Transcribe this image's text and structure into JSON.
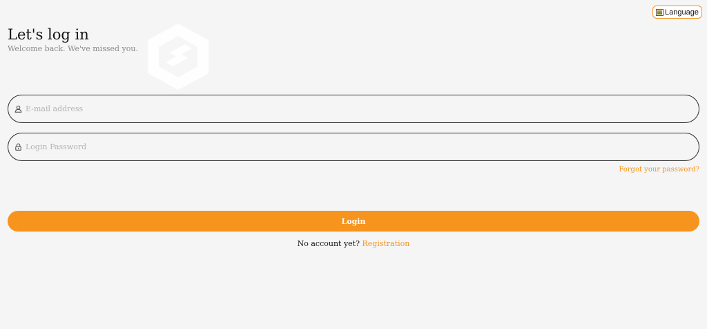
{
  "header": {
    "language_label": "Language",
    "language_icon": "flag-icon"
  },
  "hero": {
    "title": "Let's log in",
    "subtitle": "Welcome back. We've missed you."
  },
  "form": {
    "email": {
      "placeholder": "E-mail address",
      "value": "",
      "icon": "user-icon"
    },
    "password": {
      "placeholder": "Login Password",
      "value": "",
      "icon": "lock-icon"
    },
    "forgot_label": "Forgot your password?",
    "login_label": "Login",
    "no_account_text": "No account yet?",
    "register_label": "Registration"
  },
  "colors": {
    "accent": "#f7941d",
    "background": "#f5f5f5",
    "field_border": "#2b2b2b",
    "placeholder": "#b3b3b3"
  }
}
